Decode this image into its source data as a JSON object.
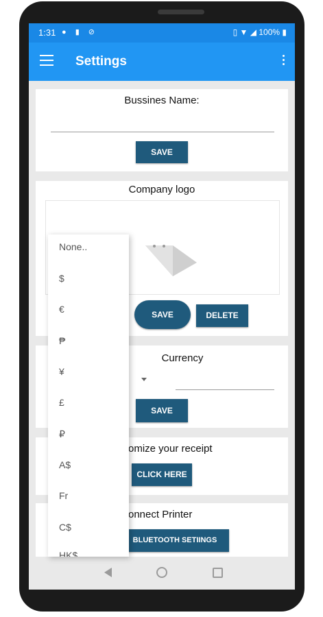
{
  "status_bar": {
    "time": "1:31",
    "battery": "100%"
  },
  "app_bar": {
    "title": "Settings"
  },
  "business": {
    "label": "Bussines Name:",
    "value": "",
    "save_label": "SAVE"
  },
  "logo": {
    "label": "Company logo",
    "save_label": "SAVE",
    "delete_label": "DELETE"
  },
  "currency": {
    "label": "Currency",
    "save_label": "SAVE",
    "options": [
      "None..",
      "$",
      "€",
      "₱",
      "¥",
      "£",
      "₽",
      "A$",
      "Fr",
      "C$",
      "HK$"
    ]
  },
  "receipt": {
    "label": "omize your receipt",
    "button_label": "CLICK HERE"
  },
  "printer": {
    "label": "onnect Printer",
    "button_label": "BLUETOOTH SETIINGS"
  },
  "icons": [
    "menu-icon",
    "more-vert-icon",
    "image-placeholder-icon",
    "dropdown-arrow-icon",
    "back-icon",
    "home-icon",
    "recents-icon",
    "wifi-icon",
    "battery-icon"
  ]
}
